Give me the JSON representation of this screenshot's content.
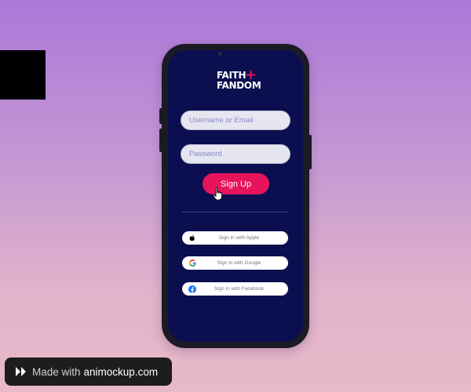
{
  "logo": {
    "line1": "FAITH",
    "line2": "FANDOM",
    "plus": "+"
  },
  "form": {
    "username_placeholder": "Username or Email",
    "password_placeholder": "Password",
    "signup_label": "Sign Up"
  },
  "social": {
    "apple_label": "Sign in with Apple",
    "google_label": "Sign in with Google",
    "facebook_label": "Sign in with Facebook"
  },
  "watermark": {
    "made_with": "Made with",
    "site": "animockup.com"
  },
  "colors": {
    "accent": "#e8135d",
    "screen": "#0b0f4f",
    "facebook": "#1877f2"
  },
  "icons": [
    "apple-icon",
    "google-icon",
    "facebook-icon",
    "pointer-cursor-icon",
    "animockup-logo-icon"
  ]
}
